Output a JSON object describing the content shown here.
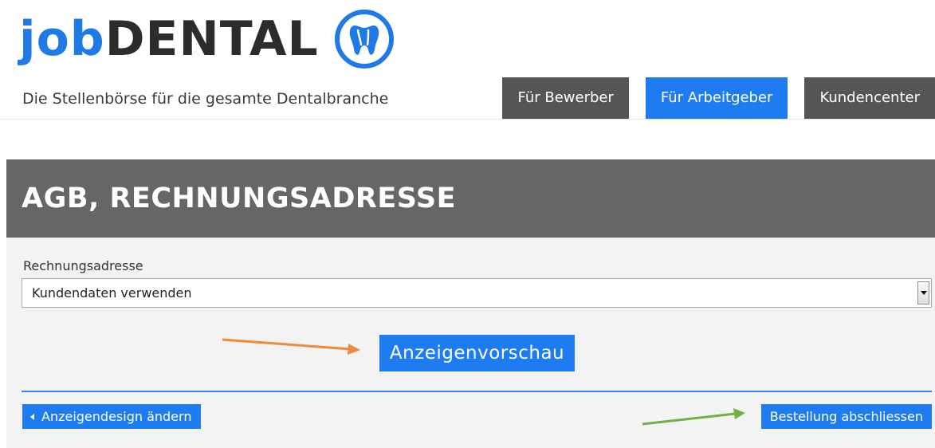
{
  "header": {
    "logo_job": "job",
    "logo_dental": "DENTAL",
    "tagline": "Die Stellenbörse für die gesamte Dentalbranche",
    "logo_icon": "tooth-icon",
    "brand_color": "#1f7ae8"
  },
  "nav": {
    "items": [
      {
        "label": "Für Bewerber",
        "active": false
      },
      {
        "label": "Für Arbeitgeber",
        "active": true
      },
      {
        "label": "Kundencenter",
        "active": false
      }
    ],
    "active_color": "#1f7cf0",
    "inactive_color": "#555555"
  },
  "section": {
    "title": "AGB, RECHNUNGSADRESSE",
    "billing_label": "Rechnungsadresse",
    "billing_select": {
      "value": "Kundendaten verwenden"
    },
    "preview_button": "Anzeigenvorschau",
    "back_button": "Anzeigendesign ändern",
    "finish_button": "Bestellung abschliessen"
  },
  "annotations": {
    "orange_arrow_color": "#f08a3c",
    "green_arrow_color": "#72b043"
  }
}
